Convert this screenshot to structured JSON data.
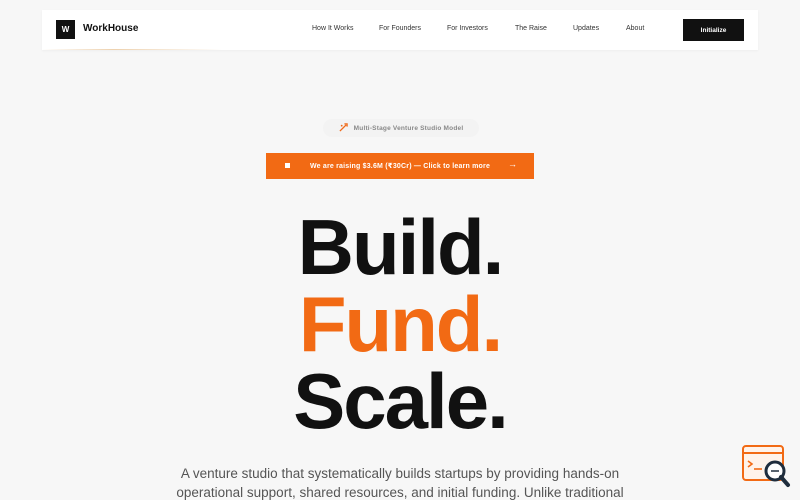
{
  "brand": {
    "logo_letter": "W",
    "name": "WorkHouse"
  },
  "nav": {
    "items": [
      {
        "label": "How It Works"
      },
      {
        "label": "For Founders"
      },
      {
        "label": "For Investors"
      },
      {
        "label": "The Raise"
      },
      {
        "label": "Updates"
      },
      {
        "label": "About"
      }
    ],
    "cta_label": "Initialize"
  },
  "pill": {
    "icon": "spark-icon",
    "text": "Multi-Stage Venture Studio Model"
  },
  "banner": {
    "text": "We are raising $3.6M (₹30Cr) — Click to learn more",
    "arrow": "→"
  },
  "hero": {
    "line1": "Build",
    "line2": "Fund",
    "line3": "Scale",
    "dot": "."
  },
  "description": "A venture studio that systematically builds startups by providing hands-on operational support, shared resources, and initial funding. Unlike traditional",
  "colors": {
    "accent": "#f26a14",
    "dark": "#111111",
    "background": "#f7f7f7"
  },
  "widget": {
    "icon": "search-chat-icon"
  }
}
